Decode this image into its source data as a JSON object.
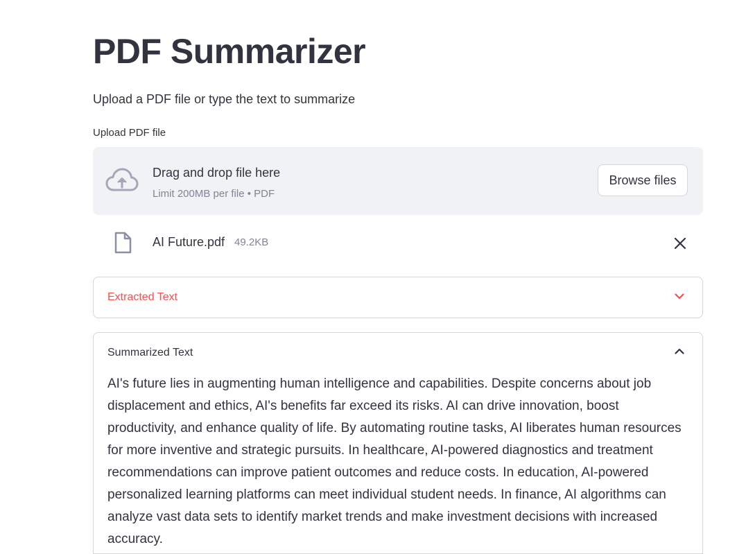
{
  "header": {
    "title": "PDF Summarizer",
    "subtitle": "Upload a PDF file or type the text to summarize"
  },
  "uploader": {
    "label": "Upload PDF file",
    "drop_title": "Drag and drop file here",
    "drop_limit": "Limit 200MB per file • PDF",
    "browse_label": "Browse files",
    "icon": "cloud-upload-icon"
  },
  "uploaded_file": {
    "name": "AI Future.pdf",
    "size": "49.2KB",
    "icon": "file-icon",
    "remove_icon": "close-icon"
  },
  "expanders": [
    {
      "label": "Extracted Text",
      "expanded": false,
      "icon": "chevron-down-icon"
    },
    {
      "label": "Summarized Text",
      "expanded": true,
      "icon": "chevron-up-icon",
      "body": "AI's future lies in augmenting human intelligence and capabilities. Despite concerns about job displacement and ethics, AI's benefits far exceed its risks. AI can drive innovation, boost productivity, and enhance quality of life. By automating routine tasks, AI liberates human resources for more inventive and strategic pursuits. In healthcare, AI-powered diagnostics and treatment recommendations can improve patient outcomes and reduce costs. In education, AI-powered personalized learning platforms can meet individual student needs. In finance, AI algorithms can analyze vast data sets to identify market trends and make investment decisions with increased accuracy."
    }
  ],
  "colors": {
    "accent": "#ff4b4b",
    "text": "#31333f",
    "muted": "#808495",
    "dropzone_bg": "#f0f2f6",
    "border": "#d6d6d9"
  }
}
